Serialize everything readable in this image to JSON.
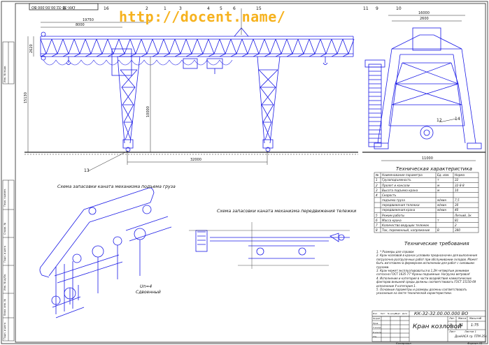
{
  "doc_number_top": "КК-32-32.00.00.000 ВО",
  "watermark": "http://docent.name/",
  "colors": {
    "drawing": "#1a1ae6",
    "frame": "#222222",
    "watermark": "#f6b21e"
  },
  "callouts": [
    "8",
    "7",
    "16",
    "2",
    "1",
    "3",
    "4",
    "5",
    "6",
    "15",
    "11",
    "9",
    "10",
    "12",
    "14",
    "13"
  ],
  "dimensions": {
    "d1": "19750",
    "d2": "8000",
    "d3": "2620",
    "d4": "15130",
    "d5": "10000",
    "d6": "32000",
    "d7": "16000",
    "d8": "2600",
    "d9": "11000"
  },
  "scheme_lift_title": "Схема запасовки каната механизма подъема груза",
  "scheme_trolley_title": "Схема запасовки каната механизма передвижения тележки",
  "pulley_label": "Uп=4",
  "pulley_sublabel": "Сдвоенный",
  "specs": {
    "title": "Техническая характеристика",
    "headers": [
      "№",
      "Наименование параметра",
      "Ед. изм.",
      "Норма"
    ],
    "rows": [
      [
        "1",
        "Грузоподъемность",
        "т",
        "32"
      ],
      [
        "2",
        "Пролет и консоли",
        "м",
        "32-8-8"
      ],
      [
        "3",
        "Высота подъема крана",
        "м",
        "10"
      ],
      [
        "4",
        "Скорость",
        "",
        ""
      ],
      [
        "",
        "подъема груза",
        "м/мин",
        "7,5"
      ],
      [
        "",
        "передвижения тележки",
        "м/мин",
        "30"
      ],
      [
        "",
        "передвижения крана",
        "м/мин",
        "40"
      ],
      [
        "5",
        "Режим работы",
        "",
        "Легкий, 3к"
      ],
      [
        "6",
        "Масса крана",
        "т",
        "81"
      ],
      [
        "7",
        "Количество ведущих тележек",
        "",
        "2"
      ],
      [
        "8",
        "Ток, переменный, напряжение",
        "В",
        "380"
      ]
    ]
  },
  "requirements": {
    "title": "Технические требования",
    "items": [
      "1. * Размеры для справок",
      "2. Кран козловой  в  кранах  условиях  предназначен  для выполнения  погрузочно-разгрузочных  работ  при  обслуживании складов. Может быть  изготовлен  в  фермерном  исполнении  для работ  с  силовыми  грузами.",
      "3. Кран  может  эксплуатироваться  в  1,2Н  четвертым  режимом согласно ГОСТ 1635-77 'Краны подъемные. Нагрузка ветровая'",
      "4. Исполнение  и  категория  в  части  воздействия  климатических факторов  внешней  среды  должны  соответствовать  ГОСТ 15150-69 исполнение У категория 1.",
      "5. Основные параметры и размеры должны соответствовать указанным на листе технической характеристики."
    ]
  },
  "title_block": {
    "doc_number": "КК-32-32.00.00.000 ВО",
    "name": "Кран козловой",
    "lit": "У",
    "mass": "81",
    "scale": "1:75",
    "sheet": "Лист",
    "sheets": "Листов 1",
    "org": "ДонНАСА гр. ПТМ-35к",
    "format": "Формат А1",
    "copied": "Копировал",
    "roles": [
      "Изм.",
      "Лист",
      "№ докум.",
      "Подп.",
      "Дата",
      "Разраб.",
      "Пров.",
      "Т.контр.",
      "Н.контр.",
      "Утв."
    ],
    "col_labels": [
      "Лит.",
      "Масса",
      "Масштаб"
    ]
  },
  "side_stamp": [
    "Перв. примен.",
    "Справ. №",
    "Подп. и дата",
    "Инв. № дубл.",
    "Взам. инв. №",
    "Подп. и дата",
    "Инв. № подл."
  ]
}
